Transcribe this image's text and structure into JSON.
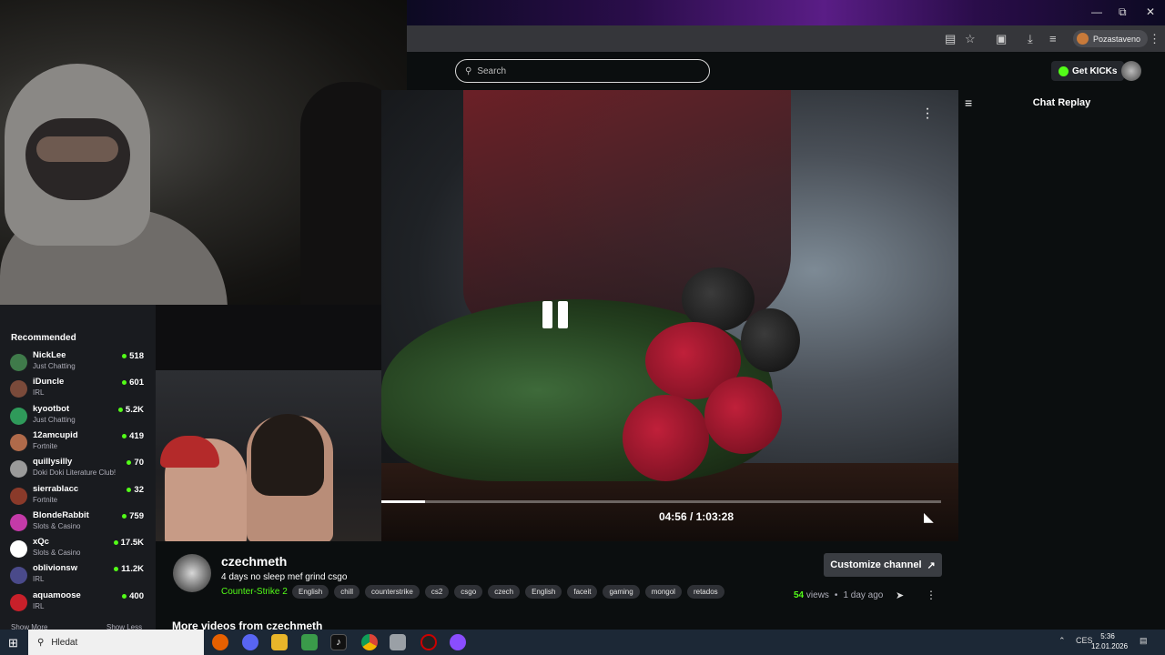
{
  "browser": {
    "profile_label": "Pozastaveno"
  },
  "kick": {
    "search_placeholder": "Search",
    "get_kicks_label": "Get KICKs"
  },
  "sidebar": {
    "title": "Recommended",
    "channels": [
      {
        "name": "NickLee",
        "category": "Just Chatting",
        "viewers": "518",
        "color": "#3f7a4a"
      },
      {
        "name": "iDuncle",
        "category": "IRL",
        "viewers": "601",
        "color": "#7a4a3a"
      },
      {
        "name": "kyootbot",
        "category": "Just Chatting",
        "viewers": "5.2K",
        "color": "#2f9a5a"
      },
      {
        "name": "12amcupid",
        "category": "Fortnite",
        "viewers": "419",
        "color": "#b06a4a"
      },
      {
        "name": "quillysilly",
        "category": "Doki Doki Literature Club!",
        "viewers": "70",
        "color": "#9a9a9a"
      },
      {
        "name": "sierrablacc",
        "category": "Fortnite",
        "viewers": "32",
        "color": "#8a3a2a"
      },
      {
        "name": "BlondeRabbit",
        "category": "Slots & Casino",
        "viewers": "759",
        "color": "#c43aa8"
      },
      {
        "name": "xQc",
        "category": "Slots & Casino",
        "viewers": "17.5K",
        "color": "#ffffff"
      },
      {
        "name": "oblivionsw",
        "category": "IRL",
        "viewers": "11.2K",
        "color": "#4a4a8a"
      },
      {
        "name": "aquamoose",
        "category": "IRL",
        "viewers": "400",
        "color": "#c8202a"
      }
    ],
    "show_more": "Show More",
    "show_less": "Show Less"
  },
  "player": {
    "time": "04:56 / 1:03:28",
    "progress_fraction": 0.078
  },
  "chat": {
    "title": "Chat Replay"
  },
  "channel": {
    "name": "czechmeth",
    "stream_title": "4 days no sleep mef grind csgo",
    "category": "Counter-Strike 2",
    "tags": [
      "English",
      "chill",
      "counterstrike",
      "cs2",
      "csgo",
      "czech",
      "English",
      "faceit",
      "gaming",
      "mongol",
      "retados"
    ],
    "customize_label": "Customize channel",
    "views_count": "54",
    "views_word": "views",
    "separator": "•",
    "age": "1 day ago",
    "more_videos": "More videos from czechmeth"
  },
  "taskbar": {
    "search_placeholder": "Hledat",
    "language": "CES",
    "time": "5:36",
    "date": "12.01.2026"
  },
  "colors": {
    "kick_green": "#53fc18",
    "sidebar_bg": "#191b1f",
    "taskbar_bg": "#1c2836"
  }
}
